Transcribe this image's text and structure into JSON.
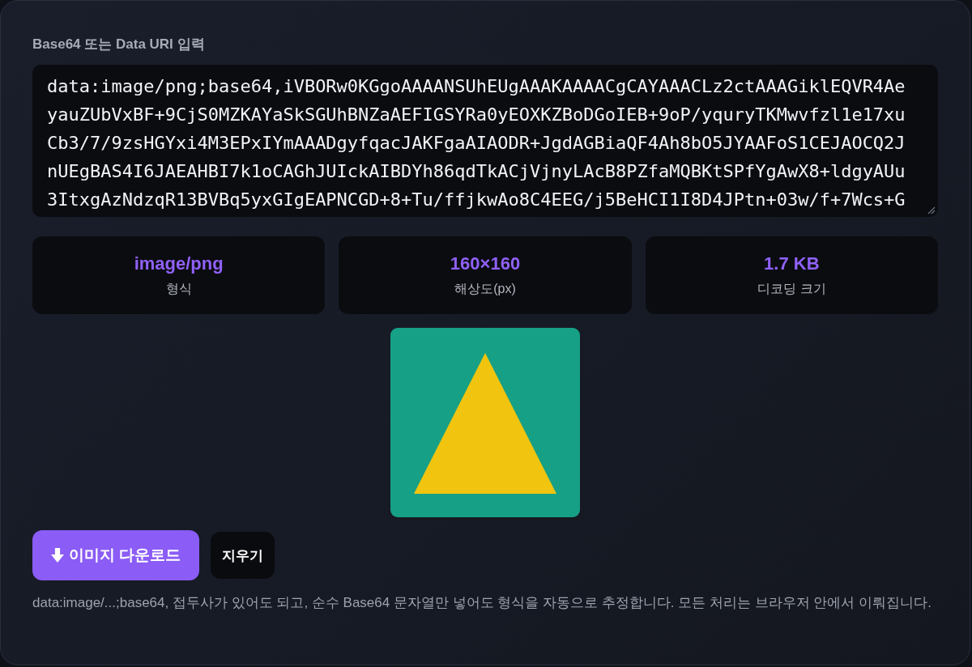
{
  "input": {
    "label": "Base64 또는 Data URI 입력",
    "value": "data:image/png;base64,iVBORw0KGgoAAAANSUhEUgAAAKAAAACgCAYAAACLz2ctAAAGiklEQVR4AeyauZUbVxBF+9CjS0MZKAYaSkSGUhBNZaAEFIGSYRa0yEOXKZBoDGoIEB+9oP/yquryTKMwvfzl1e17xuCb3/7/9zsHGYxi4M3EPxIYmAAADgyfqacJAKFgaAIAODR+JgdAGBiaQF4Ah8bO5JYAAFoS1CEJAOCQ2JnUEgBAS4I6JAEAHBI7k1oCAGhJUIckAIBDYh86qdTkACjVjnyLAcB8PZfaMQBKtSPfYgAwX8+ldgyAUu3ItxgAzNdzqR13BVBq5yxGIgEAPNCGD+8+Tu/ffjkwAo8C4EEG/j5BeHCI1I8D4JPtn+03w/f+7Wcs+G"
  },
  "stats": [
    {
      "value": "image/png",
      "label": "형식"
    },
    {
      "value": "160×160",
      "label": "해상도(px)"
    },
    {
      "value": "1.7 KB",
      "label": "디코딩 크기"
    }
  ],
  "buttons": [
    {
      "label": "이미지 다운로드",
      "kind": "primary"
    },
    {
      "label": "지우기",
      "kind": "secondary"
    }
  ],
  "hint": "data:image/...;base64, 접두사가 있어도 되고, 순수 Base64 문자열만 넣어도 형식을 자동으로 추정합니다. 모든 처리는 브라우저 안에서 이뤄집니다."
}
